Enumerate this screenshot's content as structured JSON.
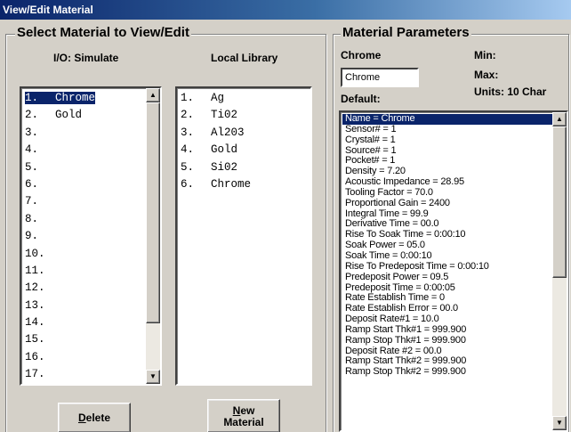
{
  "window": {
    "title": "View/Edit Material"
  },
  "select_group": {
    "legend": "Select Material to View/Edit",
    "io_header": "I/O: Simulate",
    "library_header": "Local Library",
    "io_items": [
      {
        "num": "1.",
        "name": "Chrome"
      },
      {
        "num": "2.",
        "name": "Gold"
      },
      {
        "num": "3.",
        "name": ""
      },
      {
        "num": "4.",
        "name": ""
      },
      {
        "num": "5.",
        "name": ""
      },
      {
        "num": "6.",
        "name": ""
      },
      {
        "num": "7.",
        "name": ""
      },
      {
        "num": "8.",
        "name": ""
      },
      {
        "num": "9.",
        "name": ""
      },
      {
        "num": "10.",
        "name": ""
      },
      {
        "num": "11.",
        "name": ""
      },
      {
        "num": "12.",
        "name": ""
      },
      {
        "num": "13.",
        "name": ""
      },
      {
        "num": "14.",
        "name": ""
      },
      {
        "num": "15.",
        "name": ""
      },
      {
        "num": "16.",
        "name": ""
      },
      {
        "num": "17.",
        "name": ""
      }
    ],
    "io_selected_index": 0,
    "library_items": [
      {
        "num": "1.",
        "name": "Ag"
      },
      {
        "num": "2.",
        "name": "Ti02"
      },
      {
        "num": "3.",
        "name": "Al203"
      },
      {
        "num": "4.",
        "name": "Gold"
      },
      {
        "num": "5.",
        "name": "Si02"
      },
      {
        "num": "6.",
        "name": "Chrome"
      }
    ],
    "delete_label_underlined": "D",
    "delete_label_rest": "elete",
    "new_label_underlined": "N",
    "new_label_rest": "ew",
    "new_label_line2": "Material"
  },
  "params_group": {
    "legend": "Material Parameters",
    "field_label": "Chrome",
    "min_label": "Min:",
    "max_label": "Max:",
    "field_value": "Chrome",
    "default_label": "Default:",
    "units_label": "Units: 10 Char",
    "items": [
      "Name = Chrome",
      "Sensor# = 1",
      "Crystal# = 1",
      "Source# = 1",
      "Pocket# = 1",
      "Density = 7.20",
      "Acoustic Impedance = 28.95",
      "Tooling Factor = 70.0",
      "Proportional Gain = 2400",
      "Integral Time = 99.9",
      "Derivative Time = 00.0",
      "Rise To Soak Time = 0:00:10",
      "Soak Power = 05.0",
      "Soak Time = 0:00:10",
      "Rise To Predeposit Time = 0:00:10",
      "Predeposit Power = 09.5",
      "Predeposit Time = 0:00:05",
      "Rate Establish Time = 0",
      "Rate Establish Error = 00.0",
      "Deposit Rate#1 = 10.0",
      "Ramp Start Thk#1 = 999.900",
      "Ramp Stop Thk#1 = 999.900",
      "Deposit Rate #2 = 00.0",
      "Ramp Start Thk#2 = 999.900",
      "Ramp Stop Thk#2 = 999.900"
    ],
    "selected_index": 0
  },
  "icons": {
    "scroll_up": "scroll-up-arrow-icon",
    "scroll_down": "scroll-down-arrow-icon"
  }
}
